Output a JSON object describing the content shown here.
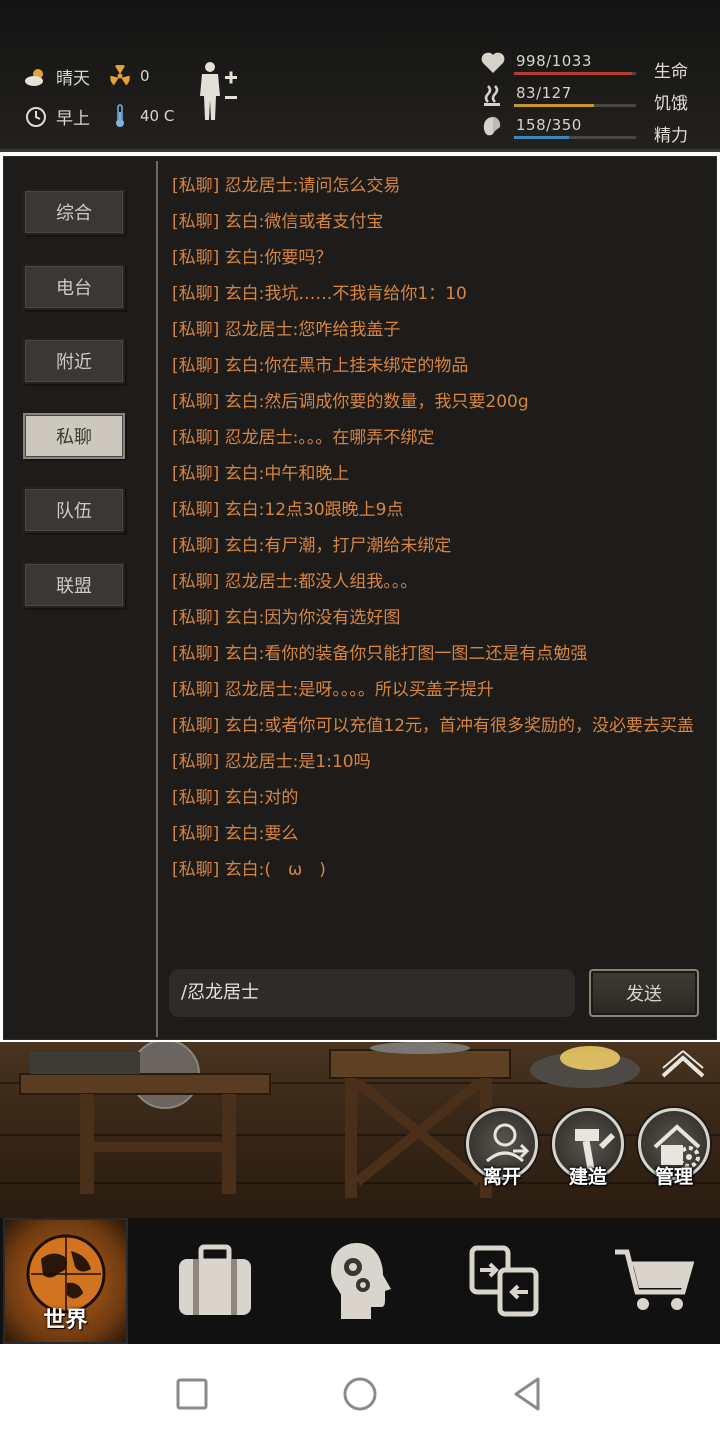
{
  "status": {
    "weather": "晴天",
    "radiation": "0",
    "time_of_day": "早上",
    "temperature": "40 C"
  },
  "bars": [
    {
      "label": "生命",
      "value": "998/1033",
      "fraction": 0.966,
      "color": "#b83a32",
      "icon": "heart-icon"
    },
    {
      "label": "饥饿",
      "value": "83/127",
      "fraction": 0.654,
      "color": "#c9962e",
      "icon": "steam-icon"
    },
    {
      "label": "精力",
      "value": "158/350",
      "fraction": 0.451,
      "color": "#3c86b8",
      "icon": "lung-icon"
    }
  ],
  "tabs": [
    "综合",
    "电台",
    "附近",
    "私聊",
    "队伍",
    "联盟"
  ],
  "active_tab": "私聊",
  "messages": [
    "[私聊] 忍龙居士:请问怎么交易",
    "[私聊] 玄白:微信或者支付宝",
    "[私聊] 玄白:你要吗？",
    "[私聊] 玄白:我坑……不我肯给你1：10",
    "[私聊] 忍龙居士:您咋给我盖子",
    "[私聊] 玄白:你在黑市上挂未绑定的物品",
    "[私聊] 玄白:然后调成你要的数量，我只要200g",
    "[私聊] 忍龙居士:。。。在哪弄不绑定",
    "[私聊] 玄白:中午和晚上",
    "[私聊] 玄白:12点30跟晚上9点",
    "[私聊] 玄白:有尸潮，打尸潮给未绑定",
    "[私聊] 忍龙居士:都没人组我。。。",
    "[私聊] 玄白:因为你没有选好图",
    "[私聊] 玄白:看你的装备你只能打图一图二还是有点勉强",
    "[私聊] 忍龙居士:是呀。。。。所以买盖子提升",
    "[私聊] 玄白:或者你可以充值12元，首冲有很多奖励的，没必要去买盖",
    "[私聊] 忍龙居士:是1:10吗",
    "[私聊] 玄白:对的",
    "[私聊] 玄白:要么",
    "[私聊] 玄白:(　ω　)"
  ],
  "chat_input": {
    "value": "/忍龙居士"
  },
  "send_label": "发送",
  "actions": {
    "leave": "离开",
    "build": "建造",
    "manage": "管理"
  },
  "nav": {
    "world": "世界"
  }
}
